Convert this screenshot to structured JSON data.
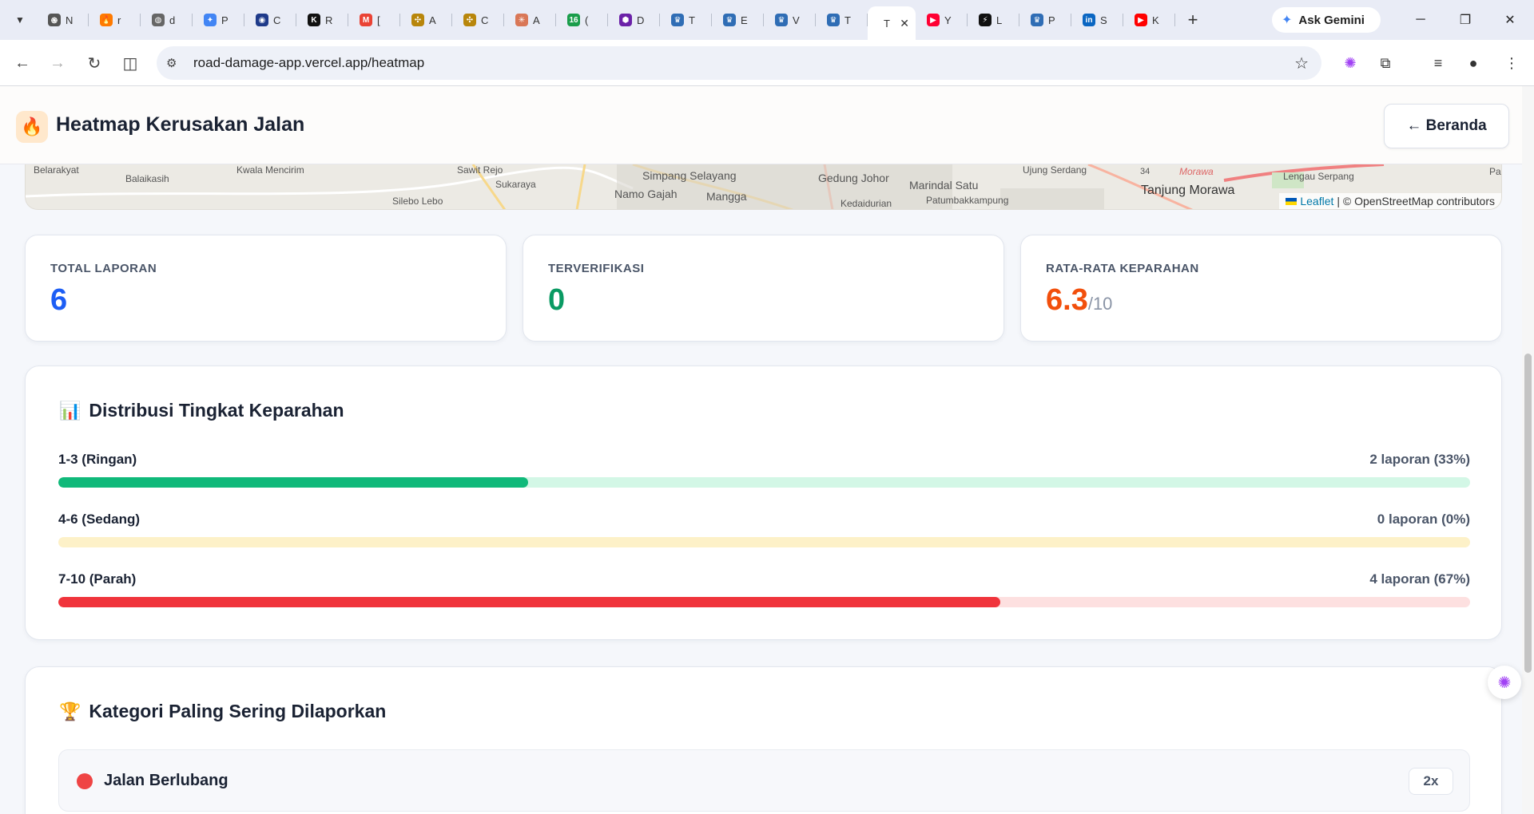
{
  "browser": {
    "tabs": [
      {
        "favicon": "openai-icon",
        "glyph": "֍",
        "color": "#555555",
        "title": "N"
      },
      {
        "favicon": "fire-icon",
        "glyph": "🔥",
        "color": "#ff7a00",
        "title": "r"
      },
      {
        "favicon": "globe-icon",
        "glyph": "◍",
        "color": "#666666",
        "title": "d"
      },
      {
        "favicon": "gemini-icon",
        "glyph": "✦",
        "color": "#4285f4",
        "title": "P"
      },
      {
        "favicon": "wifi-icon",
        "glyph": "◉",
        "color": "#1e3a8a",
        "title": "C"
      },
      {
        "favicon": "k-icon",
        "glyph": "K",
        "color": "#111111",
        "title": "R"
      },
      {
        "favicon": "gmail-icon",
        "glyph": "M",
        "color": "#ea4335",
        "title": "["
      },
      {
        "favicon": "chakra-icon",
        "glyph": "✣",
        "color": "#b8860b",
        "title": "A"
      },
      {
        "favicon": "chakra-icon",
        "glyph": "✣",
        "color": "#b8860b",
        "title": "C"
      },
      {
        "favicon": "claude-icon",
        "glyph": "✳",
        "color": "#d97757",
        "title": "A"
      },
      {
        "favicon": "number-icon",
        "glyph": "16",
        "color": "#1a9d4b",
        "title": "("
      },
      {
        "favicon": "hex-icon",
        "glyph": "⬢",
        "color": "#6b21a8",
        "title": "D"
      },
      {
        "favicon": "crest-icon",
        "glyph": "♛",
        "color": "#2f6db5",
        "title": "T"
      },
      {
        "favicon": "crest-icon",
        "glyph": "♛",
        "color": "#2f6db5",
        "title": "E"
      },
      {
        "favicon": "crest-icon",
        "glyph": "♛",
        "color": "#2f6db5",
        "title": "V"
      },
      {
        "favicon": "crest-icon",
        "glyph": "♛",
        "color": "#2f6db5",
        "title": "T"
      },
      {
        "favicon": "",
        "glyph": "",
        "color": "#ffffff",
        "title": "T",
        "active": true
      },
      {
        "favicon": "youtube-music-icon",
        "glyph": "▶",
        "color": "#ff0033",
        "title": "Y"
      },
      {
        "favicon": "bolt-icon",
        "glyph": "⚡",
        "color": "#111111",
        "title": "L"
      },
      {
        "favicon": "crest-icon",
        "glyph": "♛",
        "color": "#2f6db5",
        "title": "P"
      },
      {
        "favicon": "linkedin-icon",
        "glyph": "in",
        "color": "#0a66c2",
        "title": "S"
      },
      {
        "favicon": "youtube-icon",
        "glyph": "▶",
        "color": "#ff0000",
        "title": "K"
      }
    ],
    "gemini_label": "Ask Gemini",
    "url": "road-damage-app.vercel.app/heatmap"
  },
  "header": {
    "title": "Heatmap Kerusakan Jalan",
    "home_label": "← Beranda"
  },
  "map": {
    "labels": [
      "Belarakyat",
      "Balaikasih",
      "Kwala Mencirim",
      "Silebo Lebo",
      "Sawit Rejo",
      "Sukaraya",
      "Simpang Selayang",
      "Namo Gajah",
      "Mangga",
      "Gedung Johor",
      "Kedaidurian",
      "Marindal Satu",
      "Patumbakkampung",
      "Ujung Serdang",
      "34",
      "Morawa",
      "Tanjung Morawa",
      "Lengau Serpang",
      "Pa"
    ],
    "attribution_link": "Leaflet",
    "attribution_text": "| © OpenStreetMap contributors"
  },
  "stats": [
    {
      "label": "TOTAL LAPORAN",
      "value": "6",
      "suffix": "",
      "color": "#1d5ef5"
    },
    {
      "label": "TERVERIFIKASI",
      "value": "0",
      "suffix": "",
      "color": "#0a9a63"
    },
    {
      "label": "RATA-RATA KEPARAHAN",
      "value": "6.3",
      "suffix": "/10",
      "color": "#f24f0c"
    }
  ],
  "distribution": {
    "emoji": "📊",
    "title": "Distribusi Tingkat Keparahan",
    "rows": [
      {
        "label": "1-3 (Ringan)",
        "count": "2 laporan (33%)",
        "percent": 33.3,
        "fill": "#10b97a",
        "track": "#d3f7e6"
      },
      {
        "label": "4-6 (Sedang)",
        "count": "0 laporan (0%)",
        "percent": 0,
        "fill": "#f5c542",
        "track": "#fdf1c8"
      },
      {
        "label": "7-10 (Parah)",
        "count": "4 laporan (67%)",
        "percent": 66.7,
        "fill": "#f0343c",
        "track": "#fde0e0"
      }
    ]
  },
  "categories": {
    "emoji": "🏆",
    "title": "Kategori Paling Sering Dilaporkan",
    "items": [
      {
        "name": "Jalan Berlubang",
        "count": "2x",
        "color": "#ef4444"
      }
    ]
  }
}
